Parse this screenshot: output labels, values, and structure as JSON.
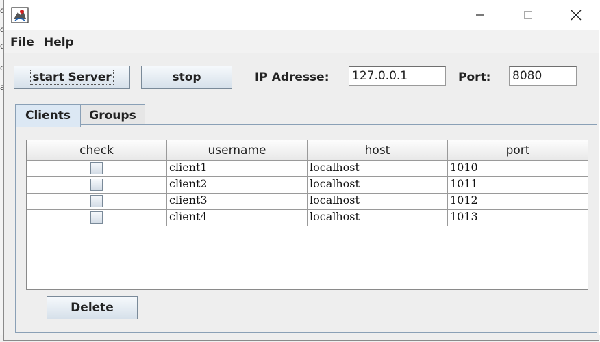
{
  "window": {
    "title": ""
  },
  "menu": {
    "items": [
      "File",
      "Help"
    ]
  },
  "toolbar": {
    "start_label": "start Server",
    "stop_label": "stop",
    "ip_label": "IP Adresse:",
    "ip_value": "127.0.0.1",
    "port_label": "Port:",
    "port_value": "8080"
  },
  "tabs": [
    {
      "label": "Clients",
      "selected": true
    },
    {
      "label": "Groups",
      "selected": false
    }
  ],
  "clients_table": {
    "columns": [
      "check",
      "username",
      "host",
      "port"
    ],
    "rows": [
      {
        "checked": false,
        "username": "client1",
        "host": "localhost",
        "port": "1010"
      },
      {
        "checked": false,
        "username": "client2",
        "host": "localhost",
        "port": "1011"
      },
      {
        "checked": false,
        "username": "client3",
        "host": "localhost",
        "port": "1012"
      },
      {
        "checked": false,
        "username": "client4",
        "host": "localhost",
        "port": "1013"
      }
    ]
  },
  "actions": {
    "delete_label": "Delete"
  },
  "colors": {
    "selected_tab": "#dce8f4",
    "button_gradient_bottom": "#d6e0ea",
    "border_accent": "#8aa0b6"
  }
}
